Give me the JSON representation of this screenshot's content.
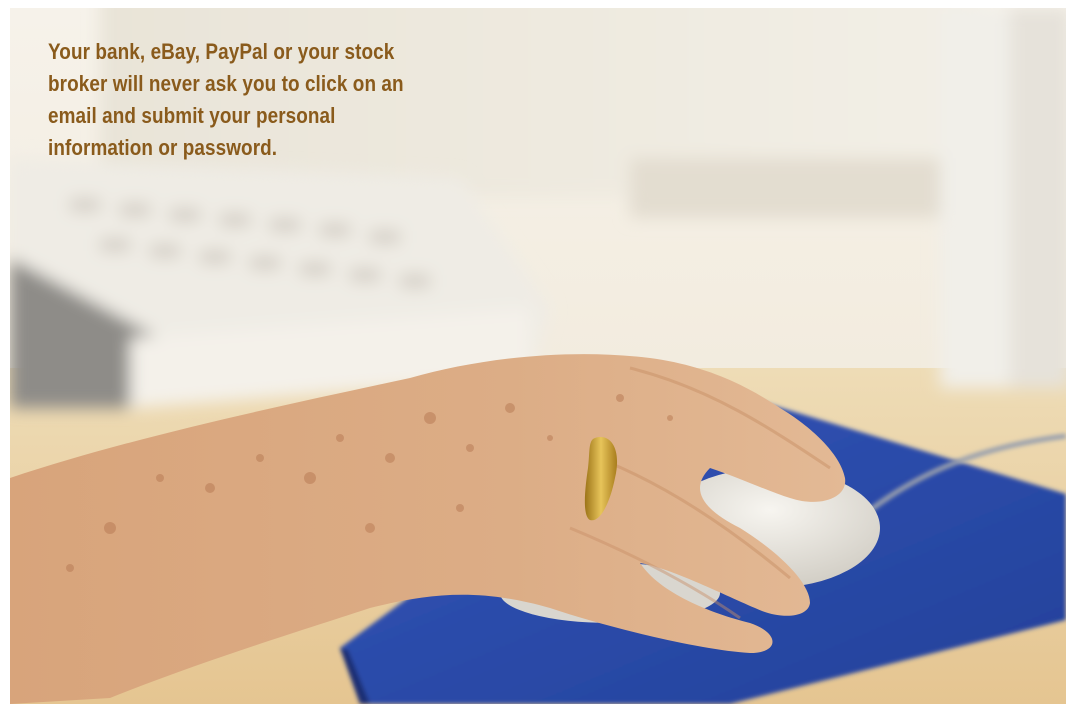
{
  "caption": {
    "text": "Your bank, eBay, PayPal or your stock broker will never ask you to click on an email and submit your personal information or password."
  },
  "colors": {
    "caption_text": "#8a5b1c",
    "wall": "#f3ede2",
    "desk": "#ead2a3",
    "mousepad": "#2b4ca8",
    "mouse": "#eae7e0",
    "skin": "#d9a57a",
    "ring": "#c89a2e"
  },
  "icons": {
    "scene": "photo-icon"
  }
}
